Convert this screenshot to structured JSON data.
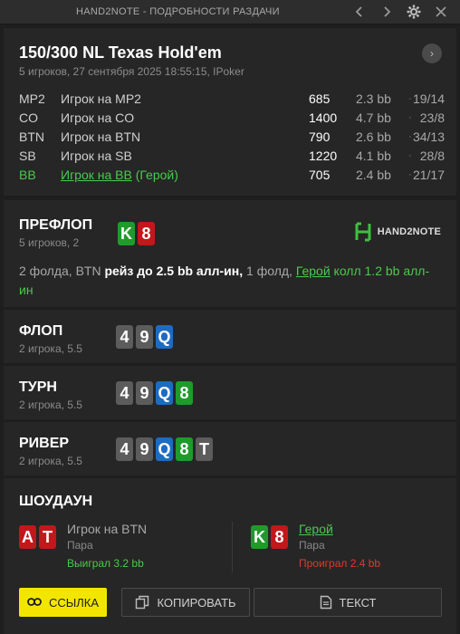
{
  "window": {
    "title": "HAND2NOTE - ПОДРОБНОСТИ РАЗДАЧИ",
    "icons": [
      "chevron-left-icon",
      "chevron-right-icon",
      "gear-icon",
      "close-icon"
    ]
  },
  "header": {
    "game_title": "150/300 NL Texas Hold'em",
    "subtitle": "5 игроков, 27 сентября 2025 18:55:15, IPoker",
    "next_icon": "›"
  },
  "players": [
    {
      "pos": "MP2",
      "name": "Игрок на MP2",
      "stack": "685",
      "bb": "2.3 bb",
      "sep": "·",
      "vpip": "19/14"
    },
    {
      "pos": "CO",
      "name": "Игрок на CO",
      "stack": "1400",
      "bb": "4.7 bb",
      "sep": "·",
      "vpip": "23/8"
    },
    {
      "pos": "BTN",
      "name": "Игрок на BTN",
      "stack": "790",
      "bb": "2.6 bb",
      "sep": "·",
      "vpip": "34/13"
    },
    {
      "pos": "SB",
      "name": "Игрок на SB",
      "stack": "1220",
      "bb": "4.1 bb",
      "sep": "·",
      "vpip": "28/8"
    },
    {
      "pos": "BB",
      "name": "Игрок на BB",
      "hero_tag": "(Герой)",
      "stack": "705",
      "bb": "2.4 bb",
      "sep": "·",
      "vpip": "21/17"
    }
  ],
  "preflop": {
    "title": "ПРЕФЛОП",
    "sub": "5 игроков, 2",
    "cards": [
      {
        "rank": "K",
        "color": "green"
      },
      {
        "rank": "8",
        "color": "red"
      }
    ],
    "logo_text": "HAND2NOTE",
    "action_a": "2 фолда, BTN ",
    "action_b": "рейз до 2.5 bb алл-ин,",
    "action_c": " 1 фолд, ",
    "action_hero": "Герой",
    "action_d": " колл 1.2 bb алл-ин"
  },
  "flop": {
    "title": "ФЛОП",
    "sub": "2 игрока, 5.5",
    "cards": [
      {
        "rank": "4",
        "color": "gray"
      },
      {
        "rank": "9",
        "color": "gray"
      },
      {
        "rank": "Q",
        "color": "blue"
      }
    ]
  },
  "turn": {
    "title": "ТУРН",
    "sub": "2 игрока, 5.5",
    "cards": [
      {
        "rank": "4",
        "color": "gray"
      },
      {
        "rank": "9",
        "color": "gray"
      },
      {
        "rank": "Q",
        "color": "blue"
      },
      {
        "rank": "8",
        "color": "green"
      }
    ]
  },
  "river": {
    "title": "РИВЕР",
    "sub": "2 игрока, 5.5",
    "cards": [
      {
        "rank": "4",
        "color": "gray"
      },
      {
        "rank": "9",
        "color": "gray"
      },
      {
        "rank": "Q",
        "color": "blue"
      },
      {
        "rank": "8",
        "color": "green"
      },
      {
        "rank": "T",
        "color": "gray"
      }
    ]
  },
  "showdown": {
    "title": "ШОУДАУН",
    "left": {
      "cards": [
        {
          "rank": "A",
          "color": "red"
        },
        {
          "rank": "T",
          "color": "red"
        }
      ],
      "name": "Игрок на BTN",
      "hand": "Пара",
      "result": "Выиграл 3.2 bb"
    },
    "right": {
      "cards": [
        {
          "rank": "K",
          "color": "green"
        },
        {
          "rank": "8",
          "color": "red"
        }
      ],
      "name": "Герой",
      "hand": "Пара",
      "result": "Проиграл 2.4 bb"
    }
  },
  "buttons": {
    "link": "ССЫЛКА",
    "copy": "КОПИРОВАТЬ",
    "text": "ТЕКСТ"
  },
  "colors": {
    "hero": "#4cc94c",
    "loss": "#e0392f",
    "accent_button": "#f2e600",
    "card_red": "#c2171b",
    "card_green": "#1f9b2b",
    "card_blue": "#1e6bc2",
    "card_gray": "#5c5c5c"
  }
}
